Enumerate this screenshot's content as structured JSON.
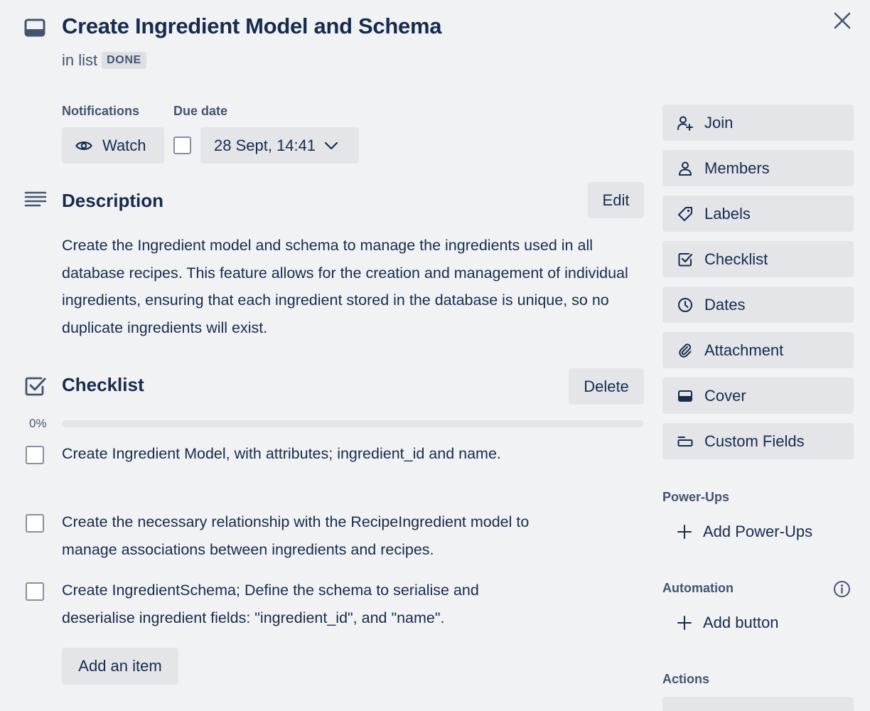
{
  "card": {
    "title": "Create Ingredient Model and Schema",
    "in_list_prefix": "in list",
    "list_name": "DONE"
  },
  "notifications": {
    "label": "Notifications",
    "watch_label": "Watch"
  },
  "due_date": {
    "label": "Due date",
    "value": "28 Sept, 14:41",
    "checked": false
  },
  "description": {
    "heading": "Description",
    "edit_label": "Edit",
    "text": "Create the Ingredient model and schema to manage the ingredients used in all database recipes. This feature allows for the creation and management of individual ingredients, ensuring that each ingredient stored in the database is unique, so no duplicate ingredients will exist."
  },
  "checklist": {
    "heading": "Checklist",
    "delete_label": "Delete",
    "progress_text": "0%",
    "progress_fraction": 0,
    "items": [
      {
        "text": "Create Ingredient Model, with attributes; ingredient_id and name.",
        "checked": false
      },
      {
        "text": "Create the necessary relationship with the RecipeIngredient model to manage associations between ingredients and recipes.",
        "checked": false
      },
      {
        "text": "Create IngredientSchema; Define the schema to serialise and deserialise ingredient fields: \"ingredient_id\", and \"name\".",
        "checked": false
      }
    ],
    "add_item_label": "Add an item"
  },
  "sidebar": {
    "buttons": [
      {
        "label": "Join",
        "icon": "add-member-icon"
      },
      {
        "label": "Members",
        "icon": "person-icon"
      },
      {
        "label": "Labels",
        "icon": "label-tag-icon"
      },
      {
        "label": "Checklist",
        "icon": "checklist-icon"
      },
      {
        "label": "Dates",
        "icon": "clock-icon"
      },
      {
        "label": "Attachment",
        "icon": "paperclip-icon"
      },
      {
        "label": "Cover",
        "icon": "cover-icon"
      },
      {
        "label": "Custom Fields",
        "icon": "custom-fields-icon"
      }
    ],
    "power_ups": {
      "heading": "Power-Ups",
      "add_label": "Add Power-Ups"
    },
    "automation": {
      "heading": "Automation",
      "add_label": "Add button"
    },
    "actions": {
      "heading": "Actions"
    }
  },
  "colors": {
    "background": "#f1f2f4",
    "button": "#e3e5e9",
    "text": "#172b4d",
    "subtle_text": "#44546f"
  }
}
